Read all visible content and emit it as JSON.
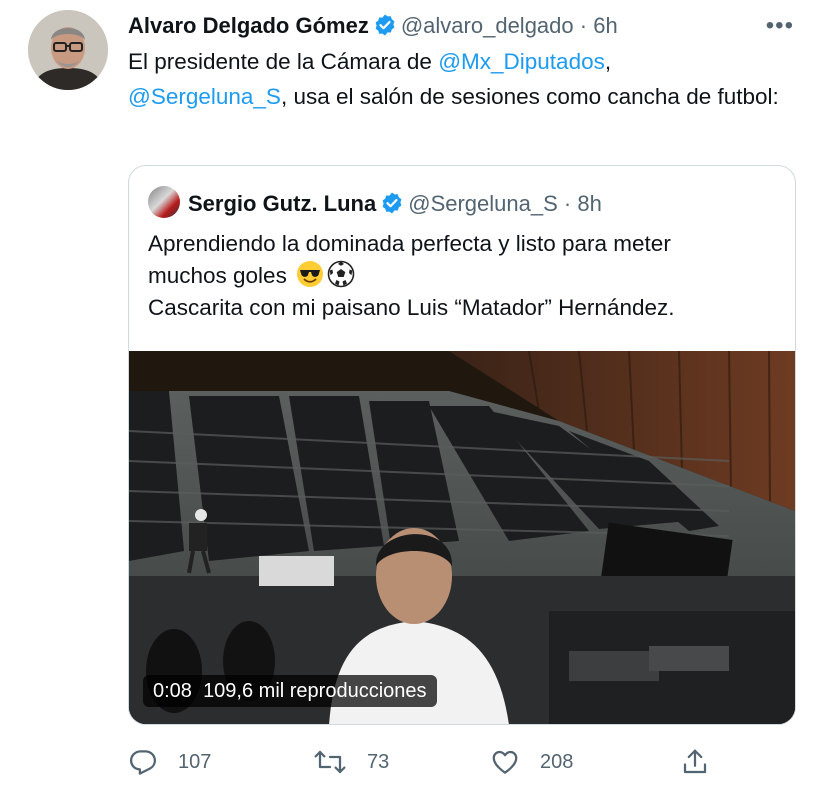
{
  "tweet": {
    "author_name": "Alvaro Delgado Gómez",
    "handle": "@alvaro_delgado",
    "separator": "·",
    "time": "6h",
    "more_label": "•••",
    "text_1": "El presidente de la Cámara de ",
    "mention_1": "@Mx_Diputados",
    "text_2": ",",
    "mention_2": "@Sergeluna_S",
    "text_3": ", usa el salón de sesiones como cancha de futbol:"
  },
  "quoted": {
    "author_name": "Sergio Gutz. Luna",
    "handle": "@Sergeluna_S",
    "separator": "·",
    "time": "8h",
    "line_1": "Aprendiendo la dominada perfecta y listo para meter",
    "line_2": "muchos goles",
    "line_3": "Cascarita con mi paisano Luis “Matador” Hernández.",
    "emojis": [
      "sunglasses-emoji",
      "soccer-ball-emoji"
    ],
    "video": {
      "duration": "0:08",
      "views": "109,6 mil reproducciones"
    }
  },
  "actions": {
    "replies": "107",
    "retweets": "73",
    "likes": "208"
  },
  "colors": {
    "link": "#1d9bf0",
    "muted": "#536471",
    "border": "#cfd9de"
  }
}
